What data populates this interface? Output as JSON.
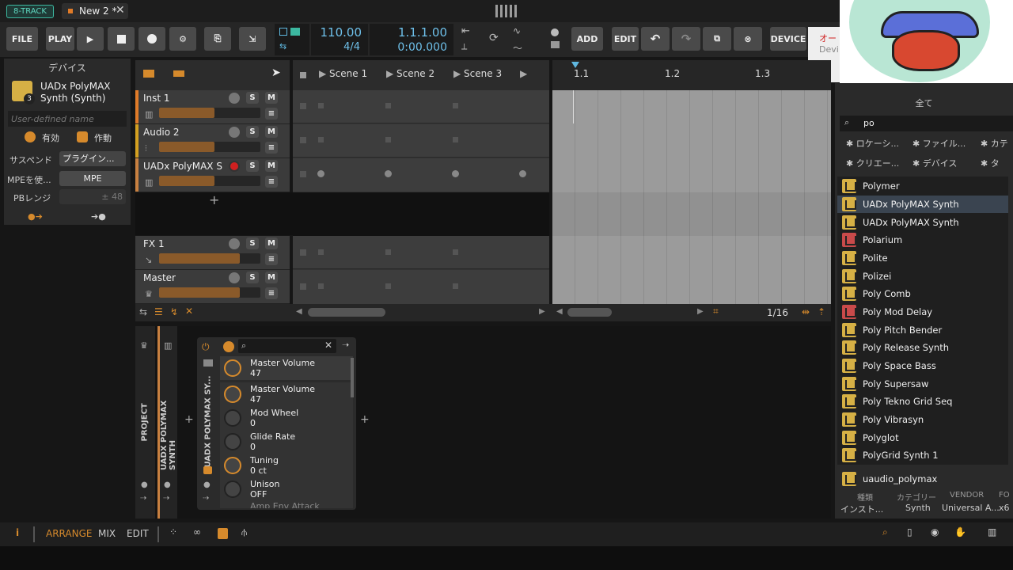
{
  "top": {
    "mode": "8-TRACK",
    "tab": "New 2 *"
  },
  "toolbar": {
    "file": "FILE",
    "play": "PLAY",
    "tempo": "110.00",
    "signature": "4/4",
    "position": "1.1.1.00",
    "time": "0:00.000",
    "add": "ADD",
    "edit": "EDIT",
    "device": "DEVICE",
    "notif_line1": "オー",
    "notif_line2": "Devi"
  },
  "device_panel": {
    "title": "デバイス",
    "device_name": "UADx PolyMAX Synth (Synth)",
    "badge": "3",
    "name_placeholder": "User-defined name",
    "enabled": "有効",
    "active": "作動",
    "suspend_label": "サスペンド",
    "suspend_value": "プラグイン...",
    "mpe_label": "MPEを使...",
    "mpe_button": "MPE",
    "pb_label": "PBレンジ",
    "pb_value": "± 48"
  },
  "tracks": [
    {
      "name": "Inst 1",
      "color": "#e07b28",
      "level": 0.55
    },
    {
      "name": "Audio 2",
      "color": "#d4a020",
      "level": 0.55
    },
    {
      "name": "UADx PolyMAX Sy...",
      "color": "#c88040",
      "level": 0.55
    },
    {
      "name": "FX 1",
      "color": "#888888",
      "level": 0.8
    },
    {
      "name": "Master",
      "color": "#888888",
      "level": 0.8
    }
  ],
  "scenes": [
    "Scene 1",
    "Scene 2",
    "Scene 3"
  ],
  "timeline": {
    "markers": [
      "1.1",
      "1.2",
      "1.3"
    ],
    "grid": "1/16"
  },
  "device_chain": {
    "project_label": "PROJECT",
    "track_label": "UADX POLYMAX SYNTH",
    "device_label": "UADX POLYMAX SY...",
    "params": [
      {
        "name": "Master Volume",
        "value": "47"
      },
      {
        "name": "Master Volume",
        "value": "47"
      },
      {
        "name": "Mod Wheel",
        "value": "0"
      },
      {
        "name": "Glide Rate",
        "value": "0"
      },
      {
        "name": "Tuning",
        "value": "0 ct"
      },
      {
        "name": "Unison",
        "value": "OFF"
      },
      {
        "name": "Amp Env Attack",
        "value": ""
      }
    ]
  },
  "browser": {
    "heading": "全て",
    "search": "po",
    "filters": [
      "ロケーシ...",
      "ファイル...",
      "カテ",
      "クリエー...",
      "デバイス",
      "タ"
    ],
    "results": [
      {
        "name": "Polymer",
        "type": "y"
      },
      {
        "name": "UADx PolyMAX Synth",
        "type": "y"
      },
      {
        "name": "UADx PolyMAX Synth",
        "type": "y"
      },
      {
        "name": "Polarium",
        "type": "r"
      },
      {
        "name": "Polite",
        "type": "y"
      },
      {
        "name": "Polizei",
        "type": "y"
      },
      {
        "name": "Poly Comb",
        "type": "y"
      },
      {
        "name": "Poly Mod Delay",
        "type": "r"
      },
      {
        "name": "Poly Pitch Bender",
        "type": "y"
      },
      {
        "name": "Poly Release Synth",
        "type": "y"
      },
      {
        "name": "Poly Space Bass",
        "type": "y"
      },
      {
        "name": "Poly Supersaw",
        "type": "y"
      },
      {
        "name": "Poly Tekno Grid Seq",
        "type": "y"
      },
      {
        "name": "Poly Vibrasyn",
        "type": "y"
      },
      {
        "name": "Polyglot",
        "type": "y"
      },
      {
        "name": "PolyGrid Synth 1",
        "type": "y"
      }
    ],
    "footer_name": "uaudio_polymax",
    "meta_headers": [
      "種類",
      "カテゴリー",
      "VENDOR",
      "FO"
    ],
    "meta_values": [
      "インスト...",
      "Synth",
      "Universal A...",
      "x6"
    ]
  },
  "bottom": {
    "info": "i",
    "arrange": "ARRANGE",
    "mix": "MIX",
    "edit": "EDIT"
  }
}
